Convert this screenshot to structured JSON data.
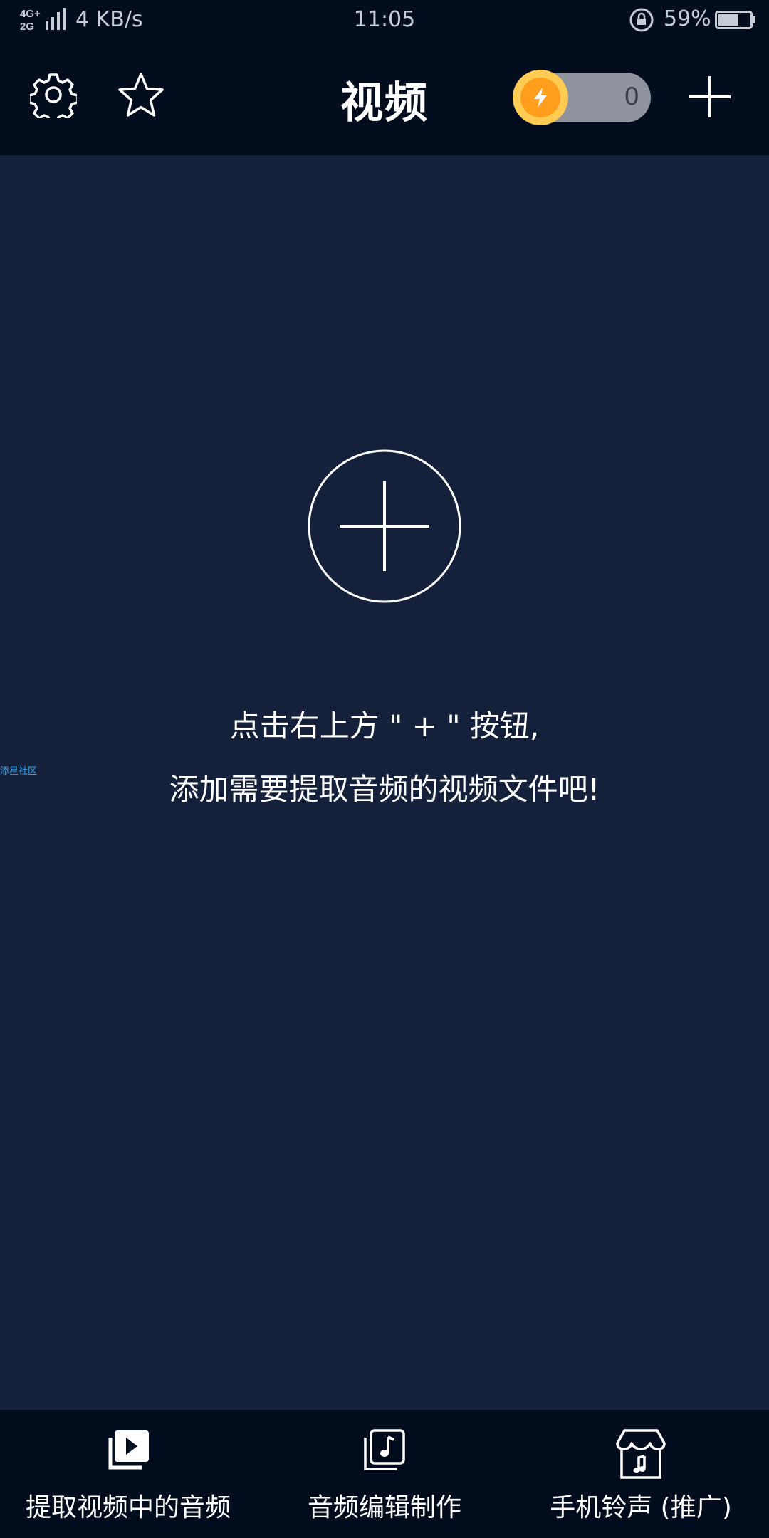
{
  "status_bar": {
    "network_top": "4G+",
    "network_bottom": "2G",
    "speed": "4 KB/s",
    "time": "11:05",
    "battery": "59%"
  },
  "header": {
    "title": "视频",
    "points": "0"
  },
  "main": {
    "hint_line_1": "点击右上方 \" + \" 按钮,",
    "hint_line_2": "添加需要提取音频的视频文件吧!",
    "watermark": "添星社区"
  },
  "bottom_nav": {
    "items": [
      {
        "label": "提取视频中的音频",
        "icon": "video-play-icon"
      },
      {
        "label": "音频编辑制作",
        "icon": "music-file-icon"
      },
      {
        "label": "手机铃声 (推广)",
        "icon": "music-store-icon"
      }
    ]
  },
  "colors": {
    "background": "#15213a",
    "bars": "#030d1e",
    "coin": "#ff9d1c",
    "pill": "#8e939d"
  }
}
